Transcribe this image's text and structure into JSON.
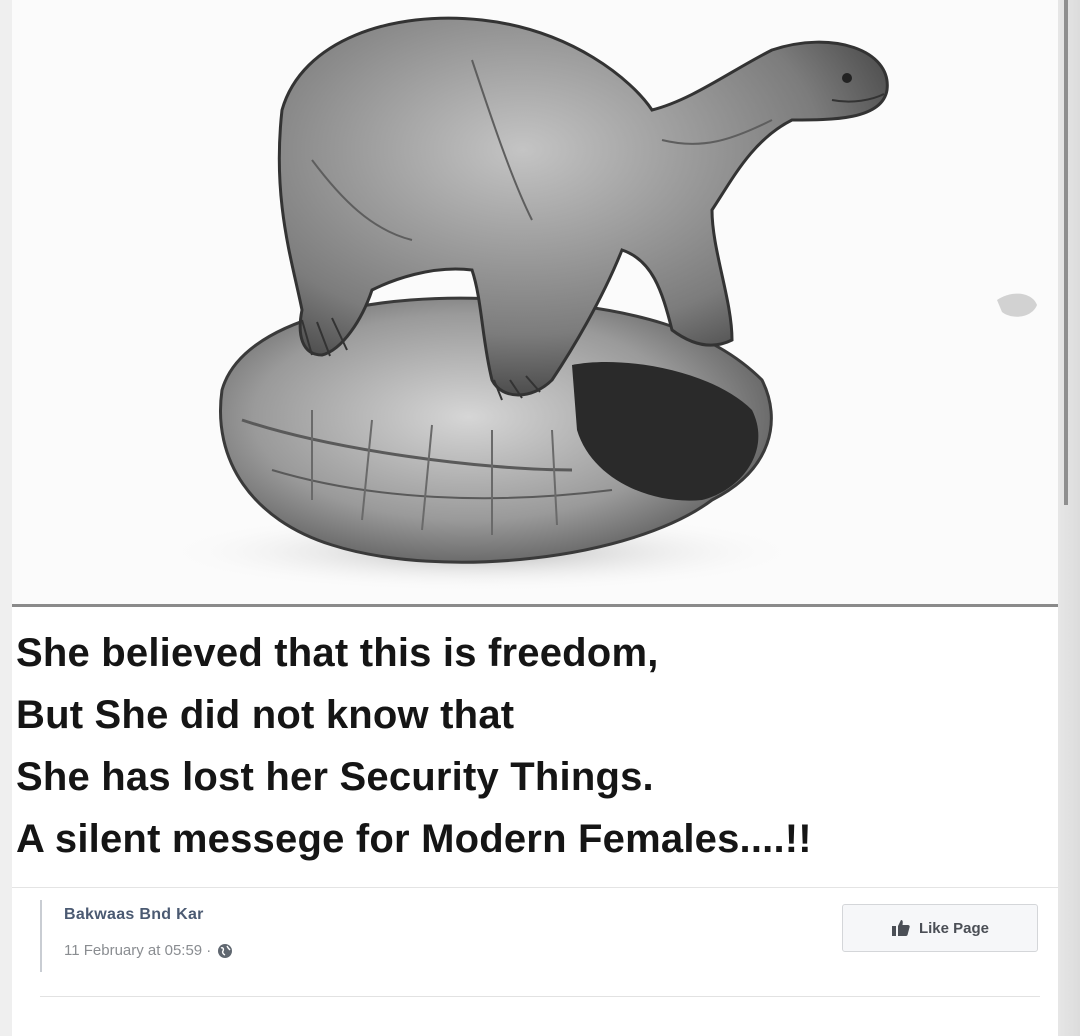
{
  "caption": {
    "line1": "She believed that this is freedom,",
    "line2": "But She did not know that",
    "line3": "She has lost her Security Things.",
    "line4": "A silent messege for Modern Females....!!"
  },
  "post": {
    "page_name": "Bakwaas Bnd Kar",
    "timestamp": "11 February at 05:59 ·",
    "privacy_icon": "globe-icon",
    "like_button_label": "Like Page",
    "like_icon": "thumbs-up-icon"
  },
  "illustration": {
    "subject": "tortoise-out-of-shell-drawing"
  },
  "colors": {
    "page_name": "#4b5a72",
    "caption_text": "#151515",
    "card_background": "#ffffff"
  }
}
